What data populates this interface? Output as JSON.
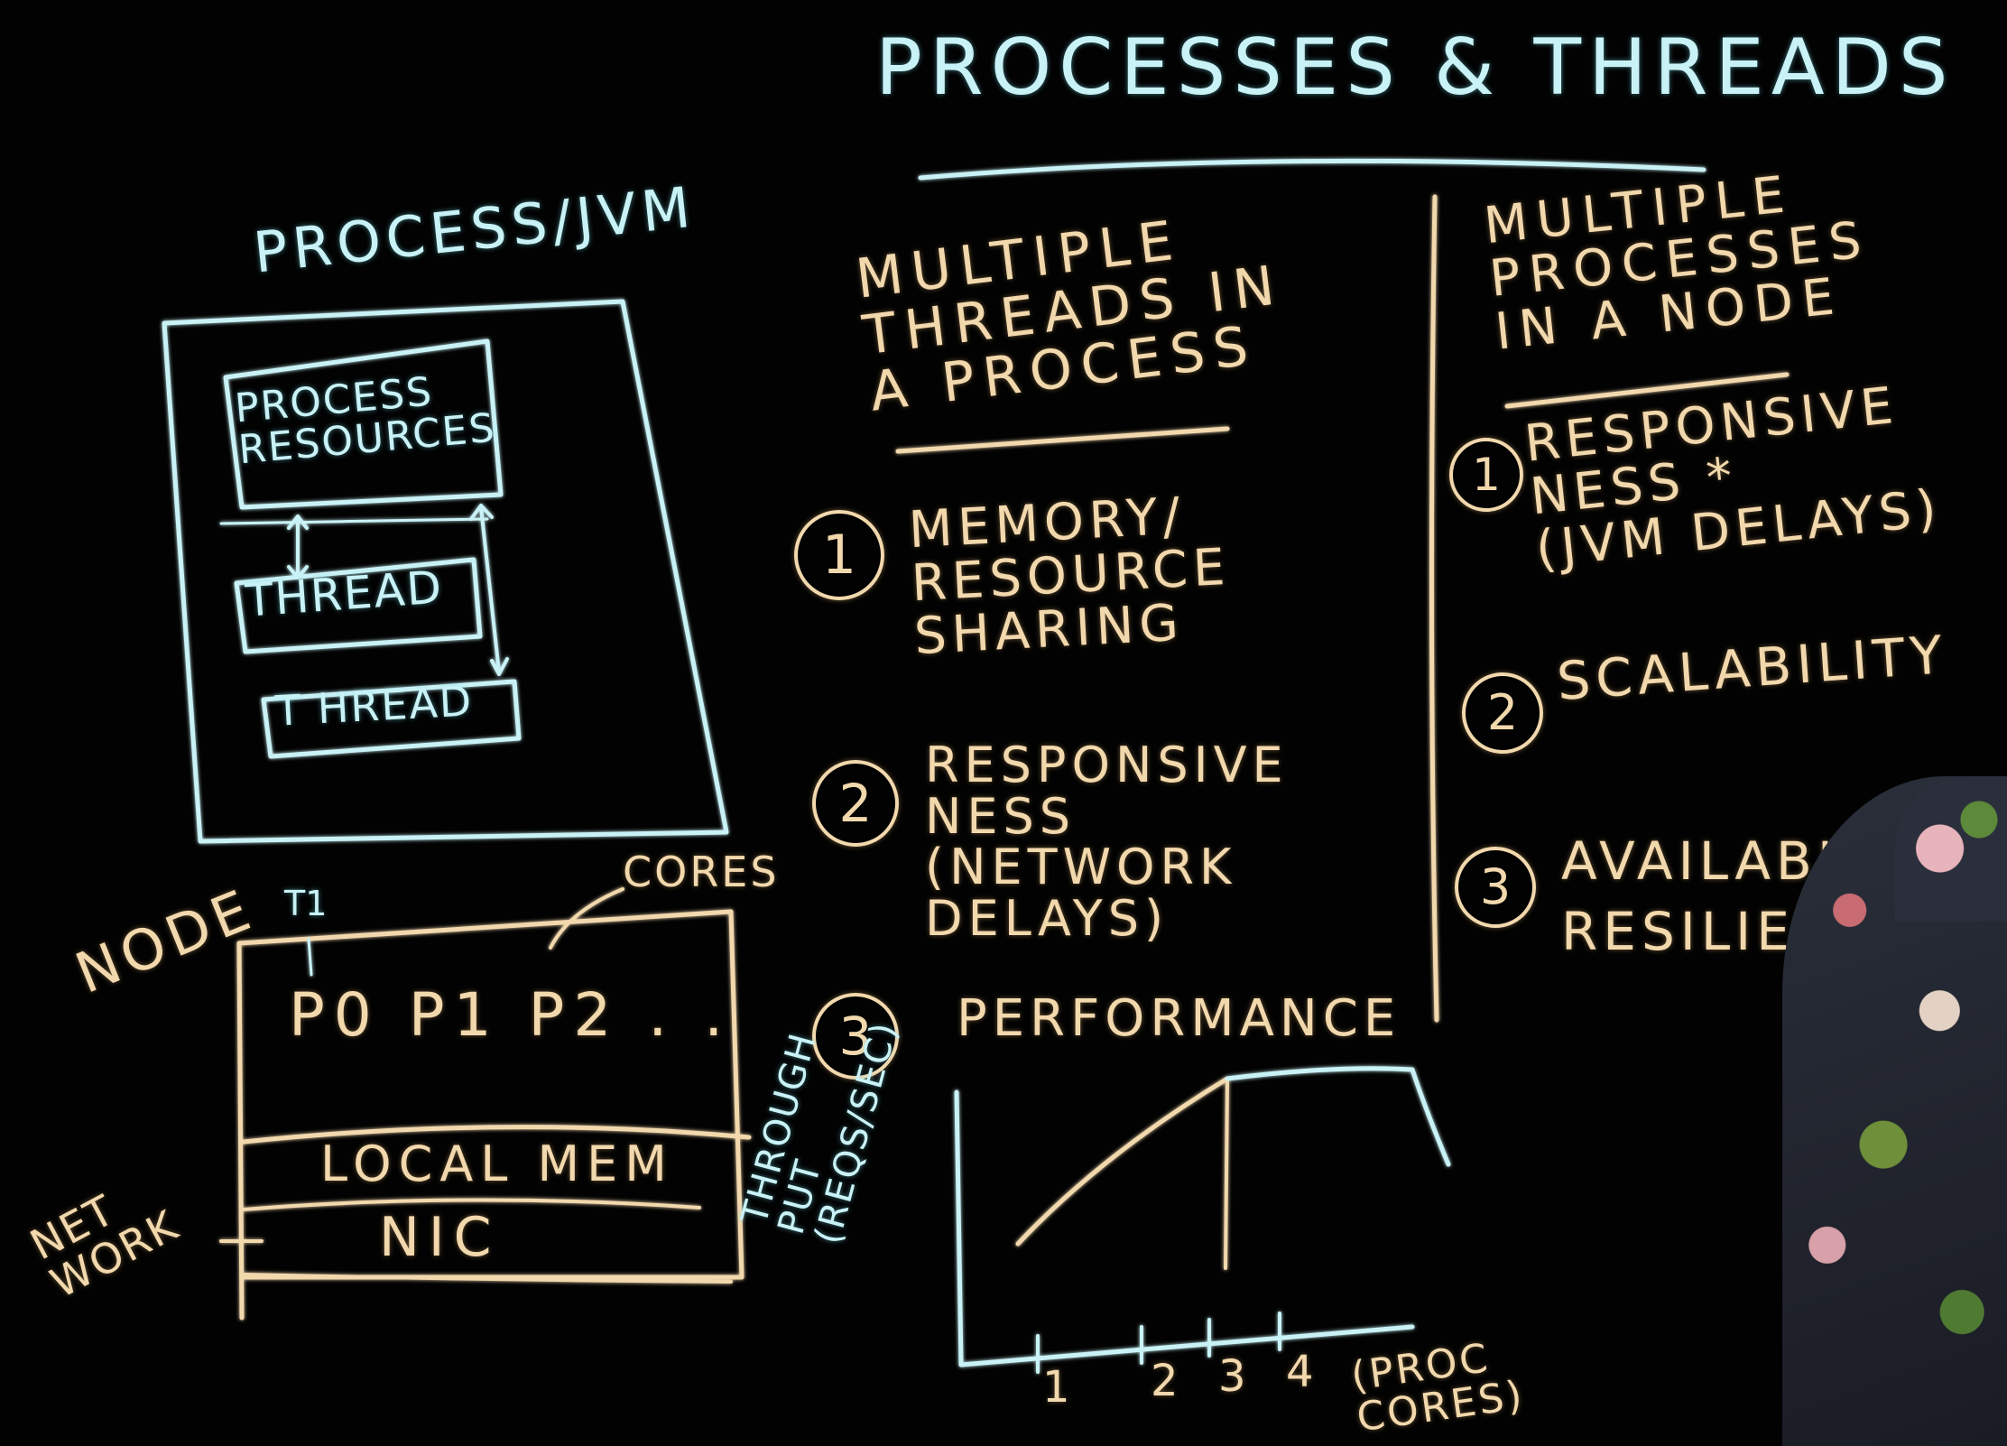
{
  "title": "PROCESSES & THREADS",
  "process": {
    "heading": "PROCESS/JVM",
    "resources": "PROCESS\nRESOURCES",
    "thread1": "THREAD",
    "thread2": "T HREAD"
  },
  "node": {
    "label": "NODE",
    "t1": "T1",
    "cores_label": "CORES",
    "cpus": "P0  P1  P2 . .",
    "local_mem": "LOCAL MEM",
    "nic": "NIC",
    "network": "NET\nWORK"
  },
  "threads_col": {
    "heading": "MULTIPLE\nTHREADS IN\nA PROCESS",
    "items": [
      {
        "num": "1",
        "text": "MEMORY/\nRESOURCE\nSHARING"
      },
      {
        "num": "2",
        "text": "RESPONSIVE\nNESS\n(NETWORK\nDELAYS)"
      },
      {
        "num": "3",
        "text": "PERFORMANCE"
      }
    ]
  },
  "processes_col": {
    "heading": "MULTIPLE\nPROCESSES\nIN A NODE",
    "items": [
      {
        "num": "1",
        "text": "RESPONSIVE\nNESS *\n(JVM DELAYS)"
      },
      {
        "num": "2",
        "text": "SCALABILITY"
      },
      {
        "num": "3",
        "text": "AVAILABILITY\nRESILIENCE"
      }
    ]
  },
  "graph": {
    "ylabel": "THROUGH\nPUT\n(REQS/SEC)",
    "xticks": [
      "1",
      "2",
      "3",
      "4"
    ],
    "xlabel": "(PROC\nCORES)"
  }
}
